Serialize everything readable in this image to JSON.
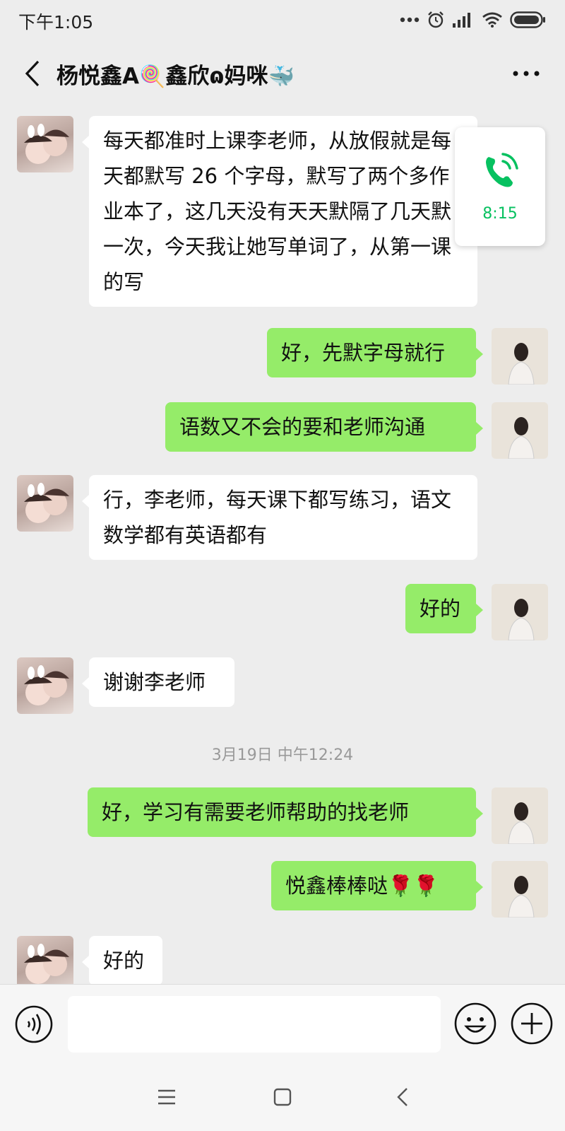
{
  "status_bar": {
    "time": "下午1:05",
    "icons": [
      "more-dots-icon",
      "alarm-icon",
      "signal-icon",
      "wifi-icon",
      "battery-icon"
    ]
  },
  "header": {
    "title": "杨悦鑫A",
    "title_emoji_1": "🍭",
    "title_mid": "鑫欣",
    "title_symbol": "ɷ",
    "title_end": "妈咪",
    "title_emoji_2": "🐳"
  },
  "call_float": {
    "duration": "8:15",
    "accent": "#07c160"
  },
  "messages": [
    {
      "sender": "other",
      "text": "每天都准时上课李老师，从放假就是每天都默写 26 个字母，默写了两个多作业本了，这几天没有天天默隔了几天默一次，今天我让她写单词了，从第一课的写"
    },
    {
      "sender": "me",
      "text": "好，先默字母就行"
    },
    {
      "sender": "me",
      "text": "语数又不会的要和老师沟通"
    },
    {
      "sender": "other",
      "text": "行，李老师，每天课下都写练习，语文数学都有英语都有"
    },
    {
      "sender": "me",
      "text": "好的"
    },
    {
      "sender": "other",
      "text": "谢谢李老师"
    },
    {
      "sender": "me",
      "text": "好，学习有需要老师帮助的找老师"
    },
    {
      "sender": "me",
      "text": "悦鑫棒棒哒🌹🌹"
    },
    {
      "sender": "other",
      "text": "好的"
    }
  ],
  "timestamp_1": "3月19日 中午12:24",
  "colors": {
    "my_bubble": "#95ec69",
    "their_bubble": "#ffffff",
    "background": "#ededed"
  },
  "input_bar": {
    "value": "",
    "icons": [
      "voice-icon",
      "emoji-icon",
      "plus-icon"
    ]
  },
  "nav_bar": {
    "icons": [
      "menu-icon",
      "home-icon",
      "back-icon"
    ]
  }
}
